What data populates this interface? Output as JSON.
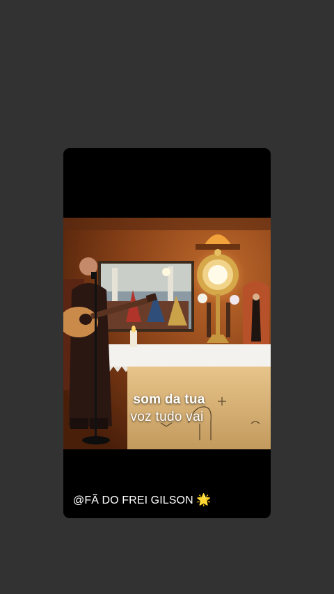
{
  "video": {
    "lyrics": {
      "line1": "som da tua",
      "line2": "voz tudo vai"
    }
  },
  "caption": {
    "text": "@FÃ DO FREI GILSON",
    "emoji": "🌟",
    "emoji_icon": "star-icon"
  },
  "colors": {
    "background": "#323232",
    "card": "#000000",
    "lyrics_text": "#ffffff",
    "caption_text": "#ffffff"
  }
}
